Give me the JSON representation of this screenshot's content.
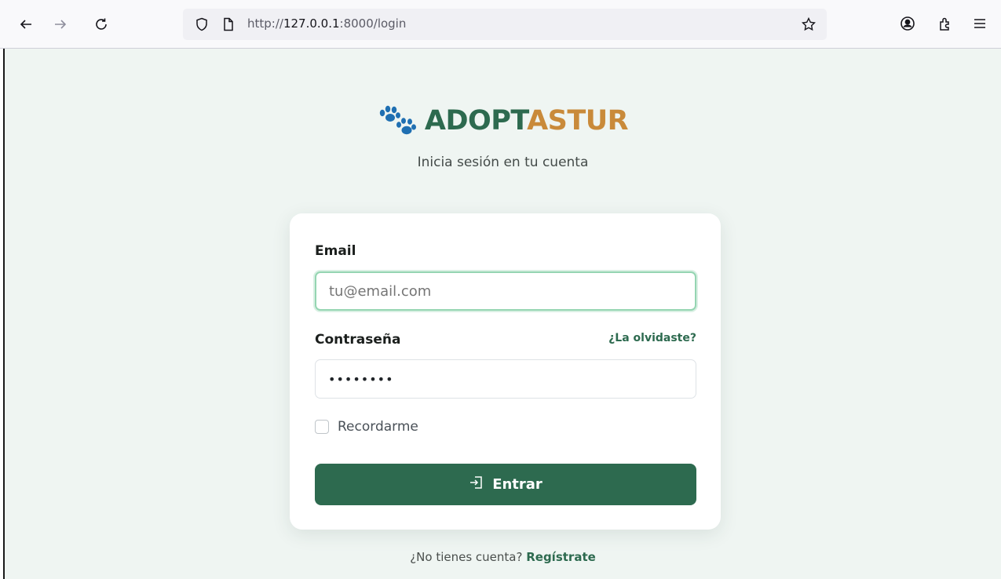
{
  "browser": {
    "url_prefix": "http://",
    "url_host": "127.0.0.1",
    "url_rest": ":8000/login",
    "icons": [
      "back-icon",
      "forward-icon",
      "reload-icon",
      "shield-icon",
      "page-icon",
      "star-icon",
      "account-icon",
      "extensions-icon",
      "menu-icon"
    ]
  },
  "brand": {
    "name_part1": "ADOPT",
    "name_part2": "ASTUR",
    "color_part1": "#2d6a4f",
    "color_part2": "#c98a3a",
    "logo_icon": "paw-icon"
  },
  "subtitle": "Inicia sesión en tu cuenta",
  "form": {
    "email_label": "Email",
    "email_placeholder": "tu@email.com",
    "password_label": "Contraseña",
    "password_value": "••••••••",
    "forgot_link": "¿La olvidaste?",
    "remember_label": "Recordarme",
    "submit_label": "Entrar",
    "submit_icon": "login-icon",
    "accent_color": "#2d6a4f"
  },
  "register": {
    "prompt": "¿No tienes cuenta?",
    "link": "Regístrate"
  }
}
